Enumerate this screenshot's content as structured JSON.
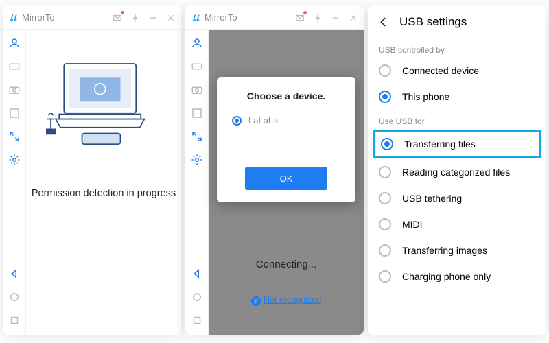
{
  "app": {
    "name": "MirrorTo"
  },
  "panel1": {
    "status_text": "Permission detection in progress"
  },
  "panel2": {
    "modal": {
      "title": "Choose a device.",
      "device_name": "LaLaLa",
      "ok_label": "OK"
    },
    "connecting_text": "Connecting...",
    "not_recognized_label": "Not recognized"
  },
  "panel3": {
    "header": "USB settings",
    "section1_label": "USB controlled by",
    "section1_options": [
      {
        "label": "Connected device",
        "selected": false
      },
      {
        "label": "This phone",
        "selected": true
      }
    ],
    "section2_label": "Use USB for",
    "section2_options": [
      {
        "label": "Transferring files",
        "selected": true,
        "highlighted": true
      },
      {
        "label": "Reading categorized files",
        "selected": false
      },
      {
        "label": "USB tethering",
        "selected": false
      },
      {
        "label": "MIDI",
        "selected": false
      },
      {
        "label": "Transferring images",
        "selected": false
      },
      {
        "label": "Charging phone only",
        "selected": false
      }
    ]
  }
}
